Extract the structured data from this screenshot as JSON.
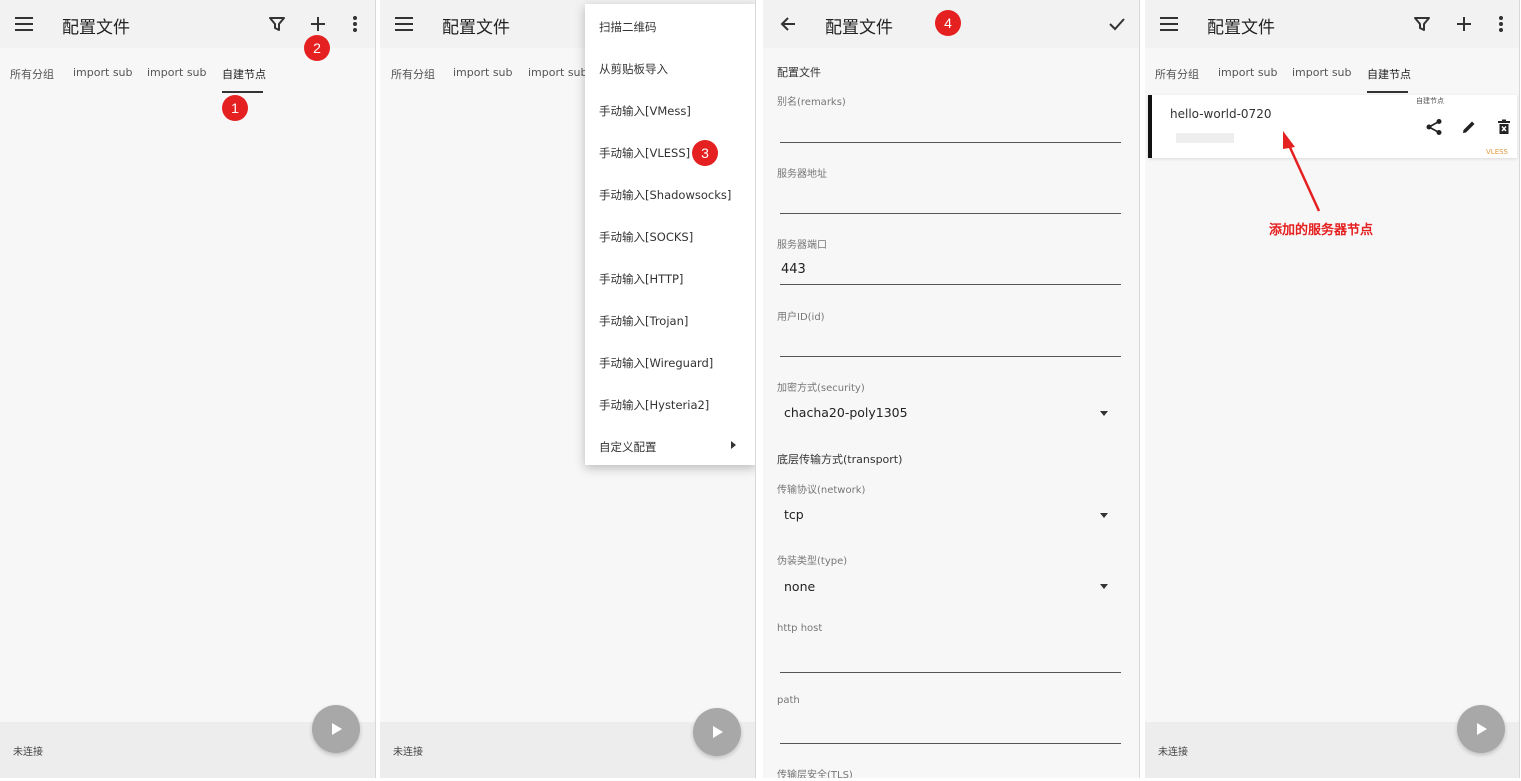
{
  "app": {
    "title": "配置文件"
  },
  "tabs": [
    "所有分组",
    "import sub",
    "import sub",
    "自建节点"
  ],
  "status": {
    "not_connected": "未连接"
  },
  "badges": [
    "1",
    "2",
    "3",
    "4"
  ],
  "menu": {
    "items": [
      "扫描二维码",
      "从剪贴板导入",
      "手动输入[VMess]",
      "手动输入[VLESS]",
      "手动输入[Shadowsocks]",
      "手动输入[SOCKS]",
      "手动输入[HTTP]",
      "手动输入[Trojan]",
      "手动输入[Wireguard]",
      "手动输入[Hysteria2]",
      "自定义配置"
    ]
  },
  "form": {
    "section": "配置文件",
    "remarks_label": "别名(remarks)",
    "remarks_value": "",
    "address_label": "服务器地址",
    "address_value": "",
    "port_label": "服务器端口",
    "port_value": "443",
    "id_label": "用户ID(id)",
    "id_value": "",
    "security_label": "加密方式(security)",
    "security_value": "chacha20-poly1305",
    "transport_title": "底层传输方式(transport)",
    "network_label": "传输协议(network)",
    "network_value": "tcp",
    "type_label": "伪装类型(type)",
    "type_value": "none",
    "host_label": "http host",
    "host_value": "",
    "path_label": "path",
    "path_value": "",
    "tls_label": "传输层安全(TLS)"
  },
  "server": {
    "name": "hello-world-0720",
    "group": "自建节点",
    "type": "VLESS"
  },
  "annotation": "添加的服务器节点",
  "colors": {
    "badge": "#e52020",
    "annotation": "#e52020",
    "type_tag": "#e39a3b"
  }
}
